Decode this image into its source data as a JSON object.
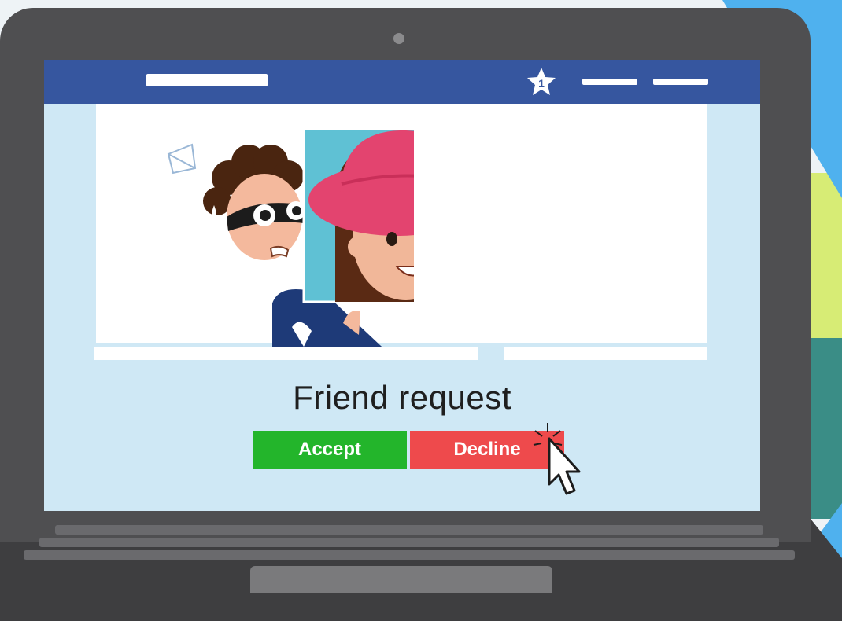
{
  "navbar": {
    "notification_count": "1"
  },
  "friend_request": {
    "title": "Friend request",
    "accept_label": "Accept",
    "decline_label": "Decline"
  },
  "colors": {
    "navbar": "#36569f",
    "screen": "#cfe8f5",
    "accept": "#23b52b",
    "decline": "#ee4a4c",
    "laptop": "#4f4f51"
  },
  "icons": [
    "notification-star-icon",
    "menu-line-icon",
    "mouse-cursor-icon",
    "click-burst-icon"
  ]
}
